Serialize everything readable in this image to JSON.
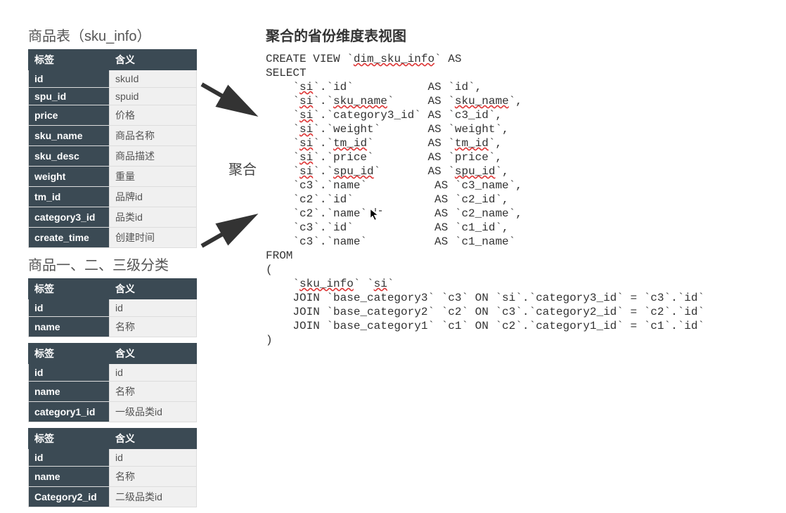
{
  "left": {
    "title1": "商品表（sku_info）",
    "table1": {
      "header": [
        "标签",
        "含义"
      ],
      "rows": [
        [
          "id",
          "skuId"
        ],
        [
          "spu_id",
          "spuid"
        ],
        [
          "price",
          "价格"
        ],
        [
          "sku_name",
          "商品名称"
        ],
        [
          "sku_desc",
          "商品描述"
        ],
        [
          "weight",
          "重量"
        ],
        [
          "tm_id",
          "品牌id"
        ],
        [
          "category3_id",
          "品类id"
        ],
        [
          "create_time",
          "创建时间"
        ]
      ]
    },
    "title2": "商品一、二、三级分类",
    "table2": {
      "header": [
        "标签",
        "含义"
      ],
      "rows": [
        [
          "id",
          "id"
        ],
        [
          "name",
          "名称"
        ]
      ]
    },
    "table3": {
      "header": [
        "标签",
        "含义"
      ],
      "rows": [
        [
          "id",
          "id"
        ],
        [
          "name",
          "名称"
        ],
        [
          "category1_id",
          "一级品类id"
        ]
      ]
    },
    "table4": {
      "header": [
        "标签",
        "含义"
      ],
      "rows": [
        [
          "id",
          "id"
        ],
        [
          "name",
          "名称"
        ],
        [
          "Category2_id",
          "二级品类id"
        ]
      ]
    }
  },
  "aggregate_label": "聚合",
  "right": {
    "title": "聚合的省份维度表视图",
    "code": {
      "l1a": "CREATE VIEW `",
      "l1b": "dim_sku_info",
      "l1c": "` AS",
      "l2": "SELECT",
      "l3a": "    `",
      "l3b": "si",
      "l3c": "`.`id`           AS `id`,",
      "l4a": "    `",
      "l4b": "si",
      "l4c": "`.`",
      "l4d": "sku_name",
      "l4e": "`     AS `",
      "l4f": "sku_name",
      "l4g": "`,",
      "l5a": "    `",
      "l5b": "si",
      "l5c": "`.`category3_id` AS `c3_id`,",
      "l6a": "    `",
      "l6b": "si",
      "l6c": "`.`weight`       AS `weight`,",
      "l7a": "    `",
      "l7b": "si",
      "l7c": "`.`",
      "l7d": "tm_id",
      "l7e": "`        AS `",
      "l7f": "tm_id",
      "l7g": "`,",
      "l8a": "    `",
      "l8b": "si",
      "l8c": "`.`price`        AS `price`,",
      "l9a": "    `",
      "l9b": "si",
      "l9c": "`.`",
      "l9d": "spu_id",
      "l9e": "`       AS `",
      "l9f": "spu_id",
      "l9g": "`,",
      "l10": "    `c3`.`name`          AS `c3_name`,",
      "l11": "    `c2`.`id`            AS `c2_id`,",
      "l12": "    `c2`.`name`          AS `c2_name`,",
      "l13": "    `c3`.`id`            AS `c1_id`,",
      "l14": "    `c3`.`name`          AS `c1_name`",
      "l15": "FROM",
      "l16": "(",
      "l17a": "    `",
      "l17b": "sku_info",
      "l17c": "` `",
      "l17d": "si",
      "l17e": "`",
      "l18": "    JOIN `base_category3` `c3` ON `si`.`category3_id` = `c3`.`id`",
      "l19": "    JOIN `base_category2` `c2` ON `c3`.`category2_id` = `c2`.`id`",
      "l20": "    JOIN `base_category1` `c1` ON `c2`.`category1_id` = `c1`.`id`",
      "l21": ")"
    }
  }
}
